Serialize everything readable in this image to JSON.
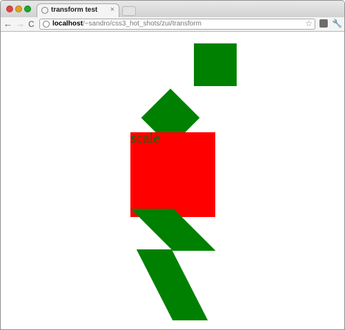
{
  "tab": {
    "title": "transform test"
  },
  "address_bar": {
    "host": "localhost",
    "path": "/~sandro/css3_hot_shots/zui/transform"
  },
  "content": {
    "scale_label": "scale"
  },
  "colors": {
    "green": "#008000",
    "red": "#ff0000"
  },
  "icons": [
    "back-arrow-icon",
    "forward-arrow-icon",
    "reload-icon",
    "site-info-icon",
    "star-icon",
    "extension-icon",
    "wrench-icon",
    "favicon-icon"
  ]
}
